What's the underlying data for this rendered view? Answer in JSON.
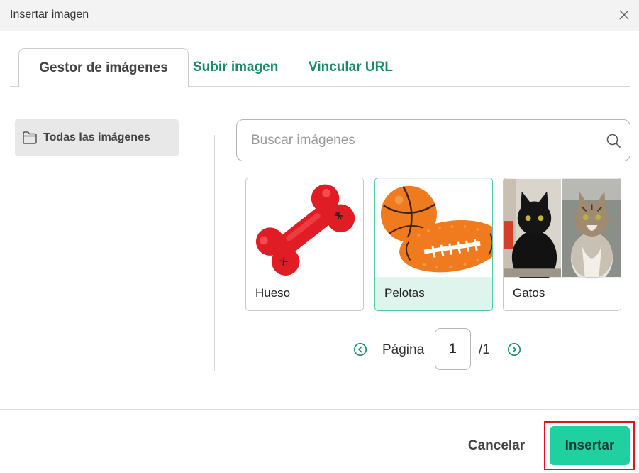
{
  "dialog": {
    "title": "Insertar imagen",
    "close_icon": "close-icon"
  },
  "tabs": [
    {
      "label": "Gestor de imágenes",
      "active": true
    },
    {
      "label": "Subir imagen",
      "active": false
    },
    {
      "label": "Vincular URL",
      "active": false
    }
  ],
  "sidebar": {
    "items": [
      {
        "label": "Todas las imágenes",
        "icon": "folder-icon",
        "selected": true
      }
    ]
  },
  "search": {
    "placeholder": "Buscar imágenes",
    "value": "",
    "icon": "search-icon"
  },
  "gallery": {
    "items": [
      {
        "name": "Hueso",
        "selected": false
      },
      {
        "name": "Pelotas",
        "selected": true
      },
      {
        "name": "Gatos",
        "selected": false
      }
    ]
  },
  "pagination": {
    "label": "Página",
    "current": "1",
    "total": "/1",
    "prev_icon": "chevron-left-circle-icon",
    "next_icon": "chevron-right-circle-icon"
  },
  "footer": {
    "cancel_label": "Cancelar",
    "insert_label": "Insertar"
  },
  "colors": {
    "accent": "#1fd1a0",
    "tab_link": "#1a8a68",
    "highlight_border": "#e3131b",
    "selected_card_bg": "#e0f4ee"
  }
}
